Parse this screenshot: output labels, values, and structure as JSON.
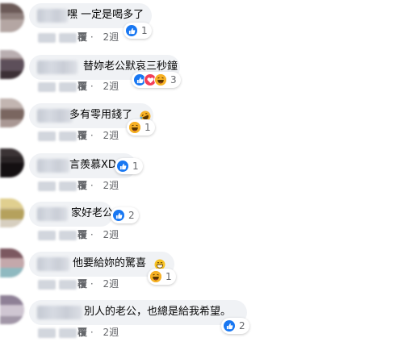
{
  "colors": {
    "bubble": "#f0f2f5",
    "like": "#1877f2",
    "love": "#f33e58",
    "haha": "#f7b125",
    "muted": "#65676b",
    "text": "#050505"
  },
  "comments": [
    {
      "text": "嘿 一定是喝多了",
      "reply": "覆",
      "time": "2週",
      "reactions": [
        "like"
      ],
      "reaction_count": "1"
    },
    {
      "text": "替妳老公默哀三秒鐘",
      "reply": "覆",
      "time": "2週",
      "reactions": [
        "like",
        "love",
        "haha"
      ],
      "reaction_count": "3"
    },
    {
      "text": "多有零用錢了",
      "reply": "覆",
      "time": "2週",
      "reactions": [
        "haha"
      ],
      "reaction_count": "1",
      "emoji": "rolling-laugh"
    },
    {
      "text": "言羨慕XD",
      "reply": "覆",
      "time": "2週",
      "reactions": [
        "like"
      ],
      "reaction_count": "1"
    },
    {
      "text": "家好老公",
      "reply": "覆",
      "time": "2週",
      "reactions": [
        "like"
      ],
      "reaction_count": "2"
    },
    {
      "text": "他要給妳的驚喜",
      "reply": "覆",
      "time": "2週",
      "reactions": [
        "haha"
      ],
      "reaction_count": "1",
      "emoji": "grinning"
    },
    {
      "text": "別人的老公，也總是給我希望。",
      "reply": "覆",
      "time": "2週",
      "reactions": [
        "like"
      ],
      "reaction_count": "2"
    }
  ]
}
